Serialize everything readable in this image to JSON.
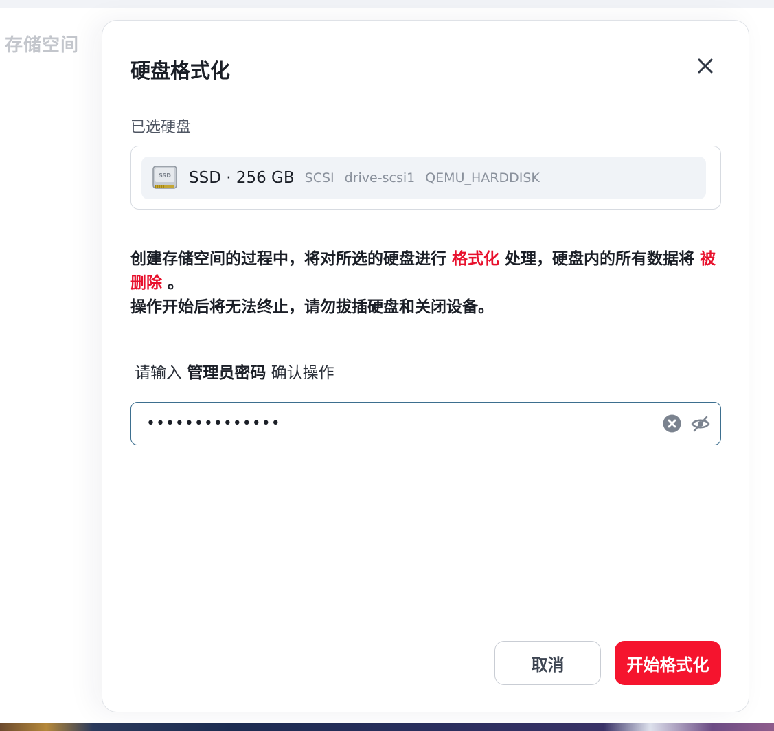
{
  "background": {
    "page_title": "存储空间"
  },
  "dialog": {
    "title": "硬盘格式化",
    "close_icon": "close-icon",
    "selected_label": "已选硬盘",
    "disk": {
      "icon": "ssd-icon",
      "icon_text": "SSD",
      "main": "SSD · 256 GB",
      "bus": "SCSI",
      "device": "drive-scsi1",
      "model": "QEMU_HARDDISK"
    },
    "warning": {
      "part1": "创建存储空间的过程中，将对所选的硬盘进行",
      "highlight1": "格式化",
      "part2": "处理，硬盘内的所有数据将",
      "highlight2": "被删除",
      "part3": "。",
      "line2": "操作开始后将无法终止，请勿拔插硬盘和关闭设备。"
    },
    "password": {
      "prompt_prefix": "请输入",
      "prompt_bold": "管理员密码",
      "prompt_suffix": "确认操作",
      "masked_value": "••••••••••••••",
      "clear_icon": "clear-icon",
      "toggle_icon": "eye-off-icon"
    },
    "buttons": {
      "cancel": "取消",
      "confirm": "开始格式化"
    }
  },
  "colors": {
    "danger": "#e8112d",
    "primary_button": "#f5142e",
    "input_border": "#3d6f8f"
  }
}
